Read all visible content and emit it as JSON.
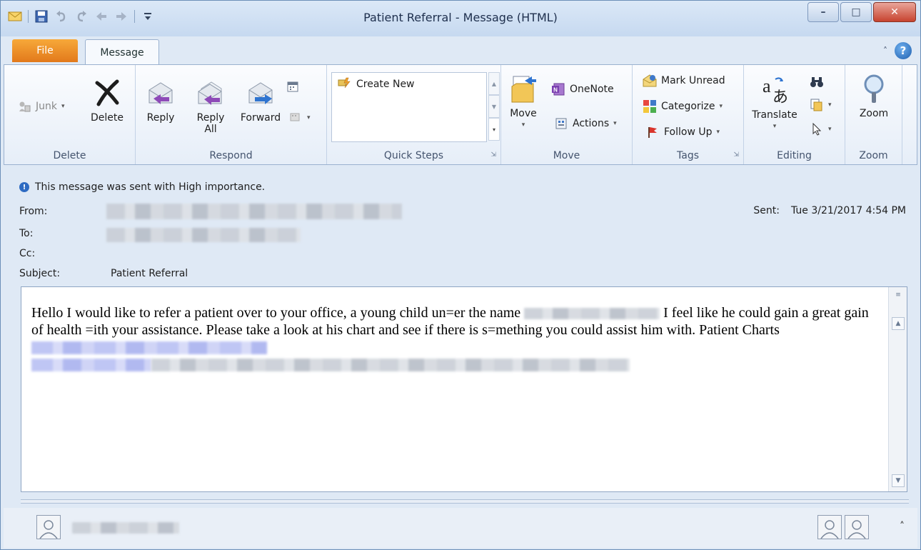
{
  "window": {
    "title": "Patient Referral - Message (HTML)"
  },
  "tabs": {
    "file": "File",
    "message": "Message"
  },
  "ribbon": {
    "delete_group": {
      "label": "Delete",
      "junk": "Junk",
      "delete": "Delete"
    },
    "respond_group": {
      "label": "Respond",
      "reply": "Reply",
      "reply_all_1": "Reply",
      "reply_all_2": "All",
      "forward": "Forward"
    },
    "quick_steps_group": {
      "label": "Quick Steps",
      "create_new": "Create New"
    },
    "move_group": {
      "label": "Move",
      "move": "Move",
      "onenote": "OneNote",
      "actions": "Actions"
    },
    "tags_group": {
      "label": "Tags",
      "mark_unread": "Mark Unread",
      "categorize": "Categorize",
      "follow_up": "Follow Up"
    },
    "editing_group": {
      "label": "Editing",
      "translate": "Translate"
    },
    "zoom_group": {
      "label": "Zoom",
      "zoom": "Zoom"
    }
  },
  "header": {
    "importance_notice": "This message was sent with High importance.",
    "from_label": "From:",
    "to_label": "To:",
    "cc_label": "Cc:",
    "subject_label": "Subject:",
    "subject": "Patient Referral",
    "sent_label": "Sent:",
    "sent_value": "Tue 3/21/2017 4:54 PM"
  },
  "body": {
    "part1": "Hello I would like to refer a patient over to your office, a young child un=er the name",
    "part2": "I feel like he could gain a great gain of health =ith your assistance. Please take a look at his chart and see if there is s=mething you could assist him with. Patient Charts"
  },
  "colors": {
    "file_tab": "#e2791b",
    "link_blur": "#b9c0f3",
    "info_icon": "#2e6bc2"
  }
}
